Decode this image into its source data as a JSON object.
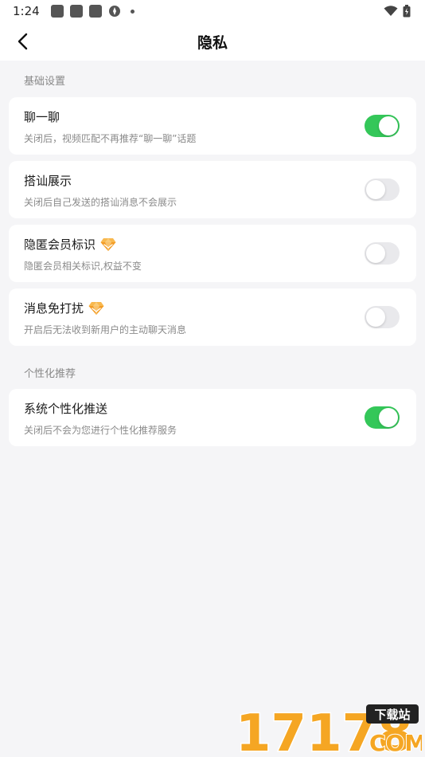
{
  "status_bar": {
    "time": "1:24"
  },
  "header": {
    "title": "隐私"
  },
  "sections": [
    {
      "label": "基础设置",
      "items": [
        {
          "title": "聊一聊",
          "desc": "关闭后，视频匹配不再推荐“聊一聊”话题",
          "on": true,
          "vip": false
        },
        {
          "title": "搭讪展示",
          "desc": "关闭后自己发送的搭讪消息不会展示",
          "on": false,
          "vip": false
        },
        {
          "title": "隐匿会员标识",
          "desc": "隐匿会员相关标识,权益不变",
          "on": false,
          "vip": true
        },
        {
          "title": "消息免打扰",
          "desc": "开启后无法收到新用户的主动聊天消息",
          "on": false,
          "vip": true
        }
      ]
    },
    {
      "label": "个性化推荐",
      "items": [
        {
          "title": "系统个性化推送",
          "desc": "关闭后不会为您进行个性化推荐服务",
          "on": true,
          "vip": false
        }
      ]
    }
  ],
  "colors": {
    "toggle_on": "#34c759",
    "toggle_off": "#e9e9ec",
    "gem": "#f5a623"
  },
  "watermark": {
    "number": "17178",
    "tag": "下载站",
    "domain": "COM"
  }
}
